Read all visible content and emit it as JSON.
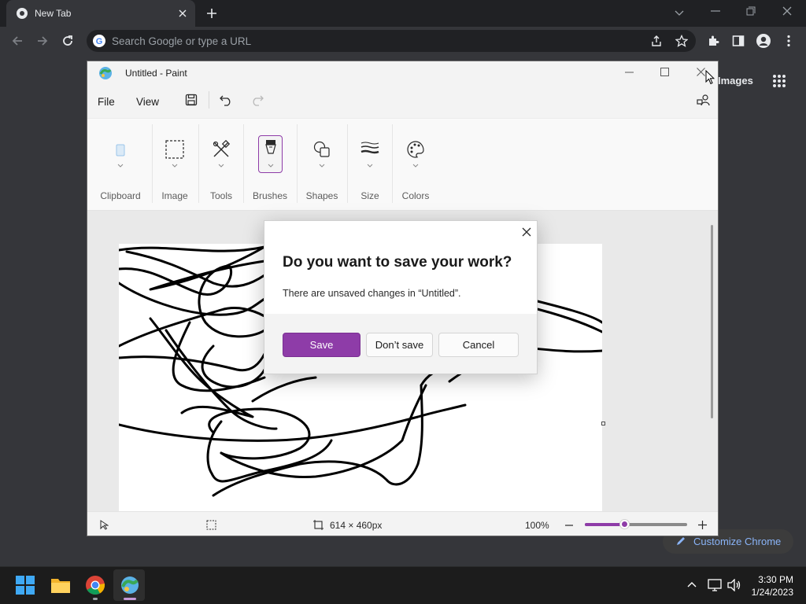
{
  "browser": {
    "tab_title": "New Tab",
    "omnibox_placeholder": "Search Google or type a URL",
    "images_link": "Images",
    "customize_label": "Customize Chrome"
  },
  "paint": {
    "window_title": "Untitled - Paint",
    "menu": {
      "file": "File",
      "view": "View"
    },
    "ribbon_groups": [
      "Clipboard",
      "Image",
      "Tools",
      "Brushes",
      "Shapes",
      "Size",
      "Colors"
    ],
    "status": {
      "canvas_size": "614 × 460px",
      "zoom": "100%",
      "zoom_level": 0.39
    }
  },
  "dialog": {
    "title": "Do you want to save your work?",
    "message": "There are unsaved changes in “Untitled”.",
    "save_label": "Save",
    "dont_save_label": "Don’t save",
    "cancel_label": "Cancel"
  },
  "taskbar": {
    "time": "3:30 PM",
    "date": "1/24/2023",
    "pinned": [
      "start-icon",
      "file-explorer-icon",
      "chrome-icon",
      "paint-icon"
    ]
  },
  "colors": {
    "accent": "#8e3ca8",
    "link": "#8ab4f8"
  }
}
